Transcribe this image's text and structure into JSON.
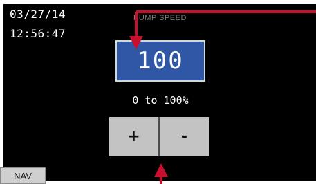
{
  "header": {
    "date": "03/27/14",
    "time": "12:56:47",
    "screen_title": "PUMP SPEED"
  },
  "main": {
    "value": "100",
    "range_label": "0 to 100%"
  },
  "controls": {
    "plus_label": "+",
    "minus_label": "-"
  },
  "footer": {
    "nav_label": "NAV"
  },
  "colors": {
    "background": "#000000",
    "value_button": "#2f57a6",
    "step_buttons": "#c3c3c3",
    "annotation_arrows": "#c8102e"
  },
  "annotations": {
    "icons": [
      "arrow-to-value-icon",
      "arrow-to-stepper-icon"
    ]
  }
}
